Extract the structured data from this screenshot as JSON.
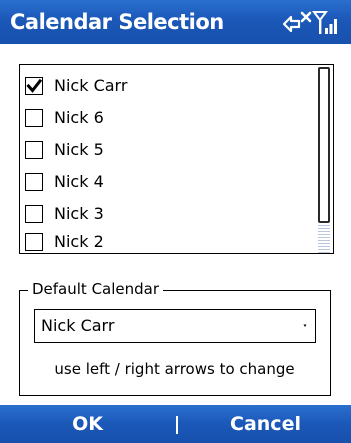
{
  "titlebar": {
    "title": "Calendar Selection",
    "icons": [
      "no-connection-icon",
      "signal-strength-icon"
    ]
  },
  "calendar_list": {
    "items": [
      {
        "label": "Nick Carr",
        "checked": true
      },
      {
        "label": "Nick 6",
        "checked": false
      },
      {
        "label": "Nick 5",
        "checked": false
      },
      {
        "label": "Nick 4",
        "checked": false
      },
      {
        "label": "Nick 3",
        "checked": false
      },
      {
        "label": "Nick 2",
        "checked": false
      }
    ]
  },
  "default_calendar": {
    "legend": "Default Calendar",
    "selected": "Nick Carr",
    "hint": "use left / right arrows to change"
  },
  "softkeys": {
    "left_label": "OK",
    "right_label": "Cancel"
  },
  "colors": {
    "bar_blue": "#1b58b8",
    "text_white": "#ffffff"
  }
}
